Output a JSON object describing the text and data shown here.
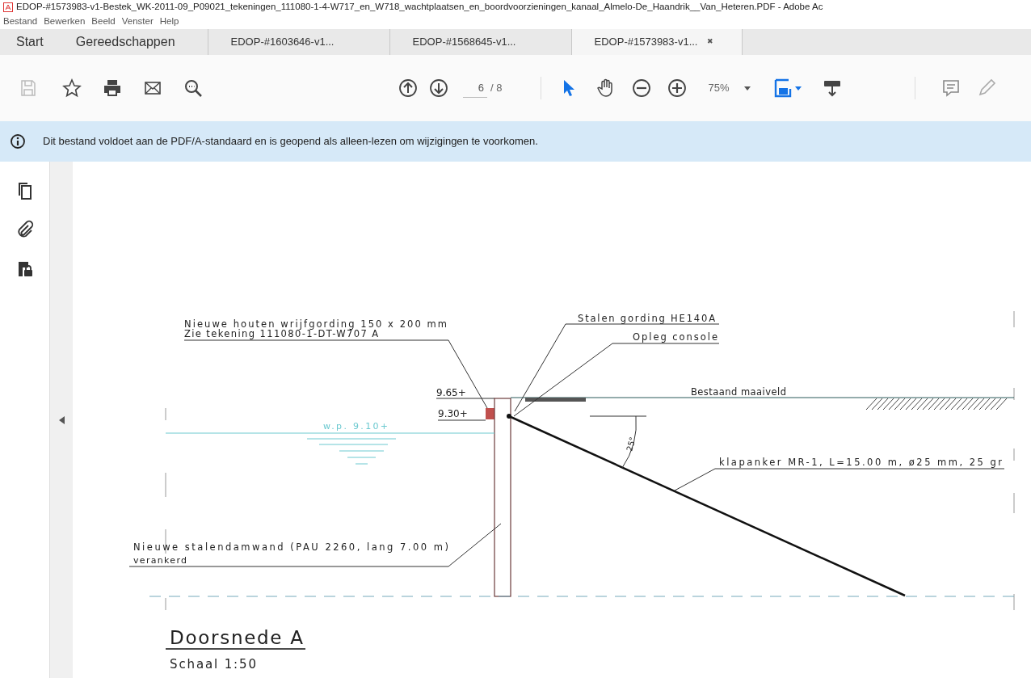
{
  "window": {
    "title": "EDOP-#1573983-v1-Bestek_WK-2011-09_P09021_tekeningen_111080-1-4-W717_en_W718_wachtplaatsen_en_boordvoorzieningen_kanaal_Almelo-De_Haandrik__Van_Heteren.PDF - Adobe Ac"
  },
  "menu": [
    "Bestand",
    "Bewerken",
    "Beeld",
    "Venster",
    "Help"
  ],
  "tabs": [
    {
      "label": "Start",
      "kind": "home",
      "selected": false
    },
    {
      "label": "Gereedschappen",
      "kind": "home",
      "selected": false
    },
    {
      "label": "EDOP-#1603646-v1...",
      "kind": "document",
      "selected": false
    },
    {
      "label": "EDOP-#1568645-v1...",
      "kind": "document",
      "selected": false
    },
    {
      "label": "EDOP-#1573983-v1...",
      "kind": "document",
      "selected": true,
      "close": "✖"
    }
  ],
  "toolbar": {
    "page": "6",
    "page_count": "/ 8",
    "zoom": "75%"
  },
  "info_bar": {
    "text": "Dit bestand voldoet aan de PDF/A-standaard en is geopend als alleen-lezen om wijzigingen te voorkomen."
  },
  "drawing": {
    "wale_note": [
      "Nieuwe houten wrijfgording 150 x 200 mm",
      "Zie tekening 111080-1-DT-W707 A"
    ],
    "steel_wale": "Stalen gording HE140A",
    "support": "Opleg console",
    "ground_level": "Bestaand maaiveld",
    "level_top": "9.65+",
    "level_wale": "9.30+",
    "water_level": "w.p. 9.10+",
    "angle": "25°",
    "anchor": "klapanker MR-1, L=15.00 m, ø25 mm, 25 gr",
    "sheet_pile": [
      "Nieuwe stalendamwand (PAU 2260, lang 7.00 m)",
      "verankerd"
    ],
    "title": "Doorsnede A",
    "scale": "Schaal 1:50"
  }
}
